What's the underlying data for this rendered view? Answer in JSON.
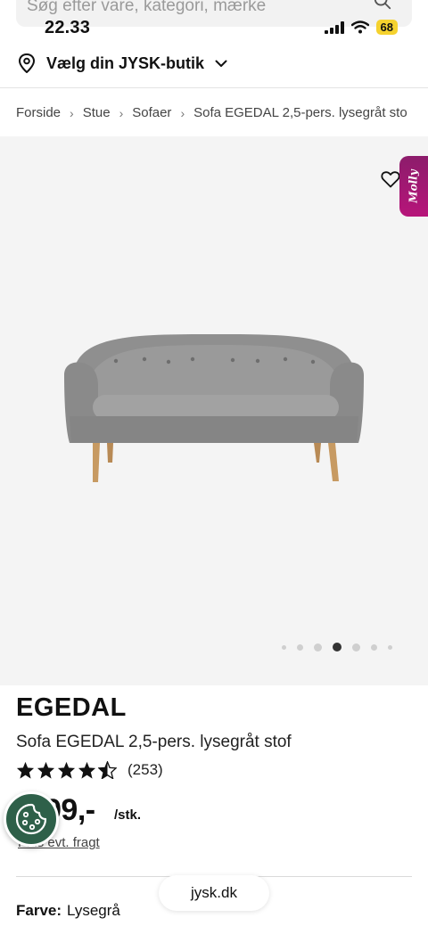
{
  "search": {
    "placeholder": "Søg efter vare, kategori, mærke"
  },
  "status_bar": {
    "time": "22.33",
    "battery": "68"
  },
  "store_selector": {
    "label": "Vælg din JYSK-butik"
  },
  "breadcrumb": [
    "Forside",
    "Stue",
    "Sofaer",
    "Sofa EGEDAL 2,5-pers. lysegråt sto"
  ],
  "hero": {
    "molly_badge": "Molly",
    "image_count": 7,
    "active_image": 4
  },
  "product": {
    "brand": "EGEDAL",
    "title": "Sofa EGEDAL 2,5-pers. lysegråt stof",
    "rating": 4.5,
    "rating_count": "(253)",
    "price": "99,-",
    "unit": "/stk.",
    "shipping_link": "Plus evt. fragt",
    "color_label": "Farve:",
    "color_value": "Lysegrå"
  },
  "browser": {
    "url": "jysk.dk"
  },
  "colors": {
    "molly": "#9b1a72",
    "cookie": "#2e6049",
    "battery": "#f5d22e"
  }
}
